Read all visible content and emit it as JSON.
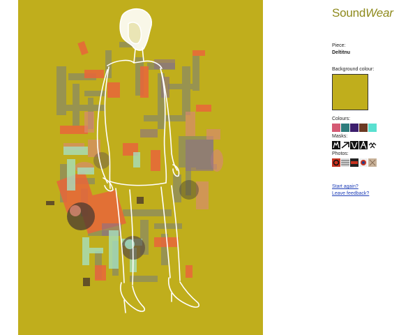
{
  "app": {
    "logo_part1": "Sound",
    "logo_part2": "Wear"
  },
  "piece": {
    "label": "Piece:",
    "name": "Deltitnu"
  },
  "background": {
    "label": "Background colour:",
    "color": "#c0ae1c"
  },
  "colours": {
    "label": "Colours:",
    "swatches": [
      "#d55a74",
      "#2f7c7c",
      "#3d1f6d",
      "#6b3a23",
      "#5ae0d0"
    ]
  },
  "masks": {
    "label": "Masks:",
    "icons": [
      "mask-icon-figure",
      "mask-icon-arrows",
      "mask-icon-splash",
      "mask-icon-leaves",
      "mask-icon-birds"
    ]
  },
  "photos": {
    "label": "Photos:",
    "icons": [
      "photo-icon-ring",
      "photo-icon-pattern",
      "photo-icon-bar",
      "photo-icon-target",
      "photo-icon-grain"
    ]
  },
  "links": {
    "start_again": "Start again?",
    "leave_feedback": "Leave feedback?"
  }
}
